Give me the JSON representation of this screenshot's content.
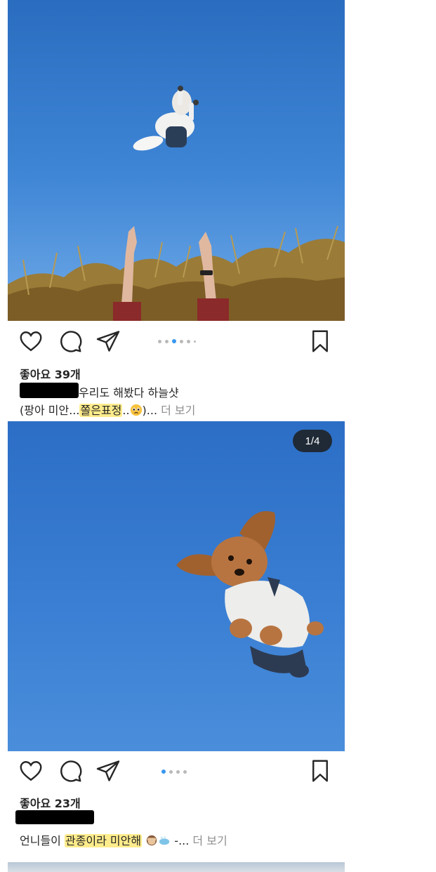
{
  "post1": {
    "likes": "좋아요 39개",
    "caption_line1": "우리도 해봤다 하늘샷",
    "caption_pre": "(팡아 미안...",
    "caption_highlight": "쫄은표정",
    "caption_mid": "..",
    "caption_post": ")...",
    "more": "더 보기",
    "emoji": "pleading-face-emoji"
  },
  "post2": {
    "counter": "1/4",
    "likes": "좋아요 23개",
    "caption_pre": "언니들이 ",
    "caption_highlight": "관종이라 미안해",
    "caption_post": " -...",
    "more": "더 보기",
    "emojis": [
      "see-no-evil-monkey-emoji",
      "soap-emoji"
    ]
  },
  "colors": {
    "sky": "#3b80d4",
    "active_dot": "#3897f0",
    "highlight": "#ffe978",
    "muted": "#8e8e8e"
  },
  "icons": [
    "heart-icon",
    "comment-icon",
    "share-icon",
    "bookmark-icon"
  ]
}
